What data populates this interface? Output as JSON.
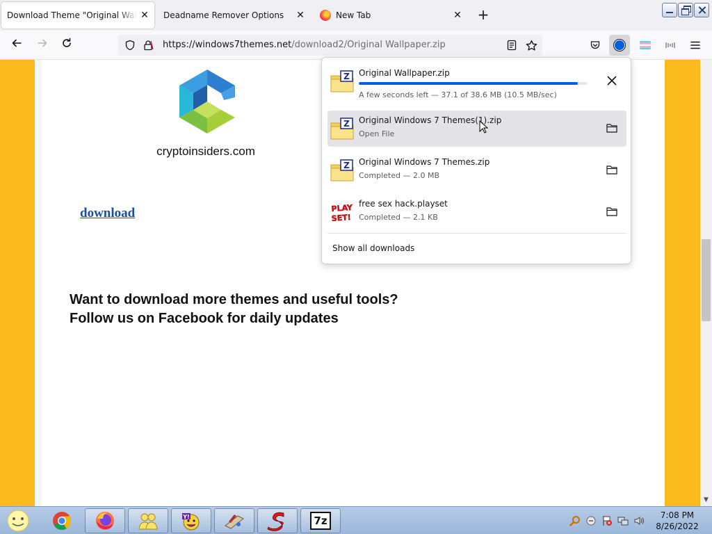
{
  "browser": {
    "tabs": [
      {
        "title": "Download Theme \"Original Wallpap"
      },
      {
        "title": "Deadname Remover Options"
      },
      {
        "title": "New Tab"
      }
    ],
    "url_host": "https://windows7themes.net",
    "url_path": "/download2/Original Wallpaper.zip"
  },
  "page": {
    "site_name": "cryptoinsiders.com",
    "download_link": "download",
    "promo_line1": "Want to download more themes and useful tools?",
    "promo_line2": "Follow us on Facebook for daily updates"
  },
  "downloads": {
    "items": [
      {
        "name": "Original Wallpaper.zip",
        "status": "A few seconds left — 37.1 of 38.6 MB (10.5 MB/sec)",
        "progress_percent": 96,
        "icon": "zip-file-icon"
      },
      {
        "name": "Original Windows 7 Themes(1).zip",
        "status": "Open File",
        "icon": "zip-file-icon"
      },
      {
        "name": "Original Windows 7 Themes.zip",
        "status": "Completed — 2.0 MB",
        "icon": "zip-file-icon"
      },
      {
        "name": "free sex hack.playset",
        "status": "Completed — 2.1 KB",
        "icon": "playset-file-icon"
      }
    ],
    "show_all": "Show all downloads",
    "playset_icon_text": "PLAY SET!"
  },
  "taskbar": {
    "time": "7:08 PM",
    "date": "8/26/2022",
    "seven_zip_label": "7z"
  },
  "colors": {
    "page_background": "#fbba1d",
    "progress_fill": "#0061e0",
    "link": "#1a4ea0"
  }
}
